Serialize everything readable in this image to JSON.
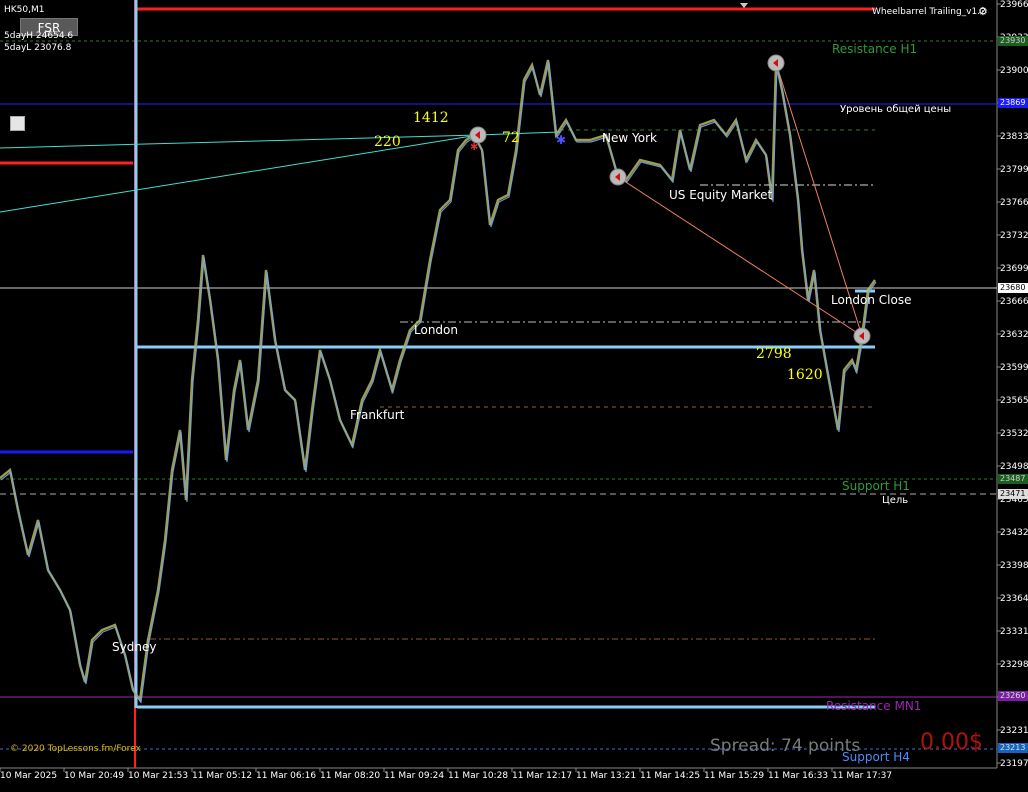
{
  "symbol": "HK50,M1",
  "fsr_button": "FSR",
  "five_day_high": "5dayH 24654.6",
  "five_day_low": "5dayL 23076.8",
  "indicator_name": "Wheelbarrel Trailing_v1.2",
  "levels": {
    "resistance_h1": "Resistance H1",
    "general_price_level": "Уровень общей цены",
    "support_h1": "Support H1",
    "target": "Цель",
    "resistance_mn1": "Resistance MN1",
    "support_h4": "Support H4",
    "london_close": "London Close"
  },
  "sessions": {
    "sydney": "Sydney",
    "frankfurt": "Frankfurt",
    "london": "London",
    "new_york": "New York",
    "us_equity": "US Equity Market"
  },
  "yellow_numbers": [
    "220",
    "1412",
    "72",
    "2798",
    "1620"
  ],
  "copyright": "© 2020 TopLessons.fm/Forex",
  "spread": "Spread: 74 points",
  "profit": "0.00$",
  "price_axis": [
    "23966",
    "23933",
    "23900",
    "23866",
    "23833",
    "23799",
    "23766",
    "23732",
    "23699",
    "23666",
    "23632",
    "23599",
    "23565",
    "23532",
    "23498",
    "23465",
    "23432",
    "23398",
    "23364",
    "23331",
    "23298",
    "23264",
    "23231",
    "23197"
  ],
  "price_tags": {
    "resistance_h1": "23930",
    "general_price": "23869",
    "current": "23680",
    "support_h1": "23487",
    "target": "23471",
    "resistance_mn1": "23260",
    "support_h4": "23213"
  },
  "time_axis": [
    "10 Mar 2025",
    "10 Mar 20:49",
    "10 Mar 21:53",
    "11 Mar 05:12",
    "11 Mar 06:16",
    "11 Mar 08:20",
    "11 Mar 09:24",
    "11 Mar 10:28",
    "11 Mar 12:17",
    "11 Mar 13:21",
    "11 Mar 14:25",
    "11 Mar 15:29",
    "11 Mar 16:33",
    "11 Mar 17:37"
  ],
  "colors": {
    "background": "#000000",
    "candles_up": "#b8b85a",
    "candles_down": "#7aa6e6",
    "resistance": "#2e7d32",
    "support_h4": "#3b6fd6",
    "mn1": "#9c27b0",
    "highlight": "#87cefa",
    "red_line": "#ff2020"
  }
}
